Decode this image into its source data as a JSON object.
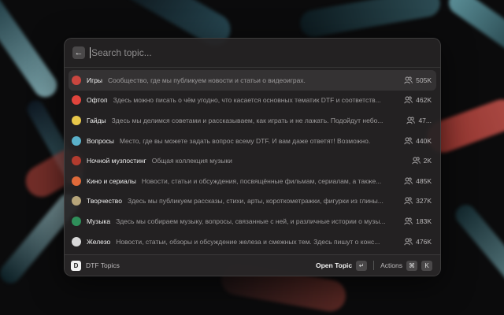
{
  "search": {
    "placeholder": "Search topic..."
  },
  "back_glyph": "←",
  "topics": [
    {
      "title": "Игры",
      "desc": "Сообщество, где мы публикуем новости и статьи о видеоиграх.",
      "count": "505K",
      "icon": "games-avatar-icon",
      "color": "#c9463f"
    },
    {
      "title": "Офтоп",
      "desc": "Здесь можно писать о чём угодно, что касается основных тематик DTF и соответств...",
      "count": "462K",
      "icon": "offtop-avatar-icon",
      "color": "#e0443c"
    },
    {
      "title": "Гайды",
      "desc": "Здесь мы делимся советами и рассказываем, как играть и не лажать. Подойдут небо...",
      "count": "47...",
      "icon": "guides-avatar-icon",
      "color": "#e8c74a"
    },
    {
      "title": "Вопросы",
      "desc": "Место, где вы можете задать вопрос всему DTF. И вам даже ответят! Возможно.",
      "count": "440K",
      "icon": "questions-avatar-icon",
      "color": "#5ab0c9"
    },
    {
      "title": "Ночной музпостинг",
      "desc": "Общая коллекция музыки",
      "count": "2K",
      "icon": "night-music-avatar-icon",
      "color": "#b23b2e"
    },
    {
      "title": "Кино и сериалы",
      "desc": "Новости, статьи и обсуждения, посвящённые фильмам, сериалам, а также...",
      "count": "485K",
      "icon": "movies-avatar-icon",
      "color": "#e06a3a"
    },
    {
      "title": "Творчество",
      "desc": "Здесь мы публикуем рассказы, стихи, арты, короткометражки, фигурки из глины...",
      "count": "327K",
      "icon": "creativity-avatar-icon",
      "color": "#b6a57a"
    },
    {
      "title": "Музыка",
      "desc": "Здесь мы собираем музыку, вопросы, связанные с ней, и различные истории о музы...",
      "count": "183K",
      "icon": "music-avatar-icon",
      "color": "#2f8f5a"
    },
    {
      "title": "Железо",
      "desc": "Новости, статьи, обзоры и обсуждение железа и смежных тем. Здесь пишут о конс...",
      "count": "476K",
      "icon": "hardware-avatar-icon",
      "color": "#d8d8d8"
    }
  ],
  "footer": {
    "logo_letter": "D",
    "app_name": "DTF Topics",
    "primary_action": "Open Topic",
    "primary_key": "↵",
    "actions_label": "Actions",
    "actions_key_1": "⌘",
    "actions_key_2": "K"
  }
}
